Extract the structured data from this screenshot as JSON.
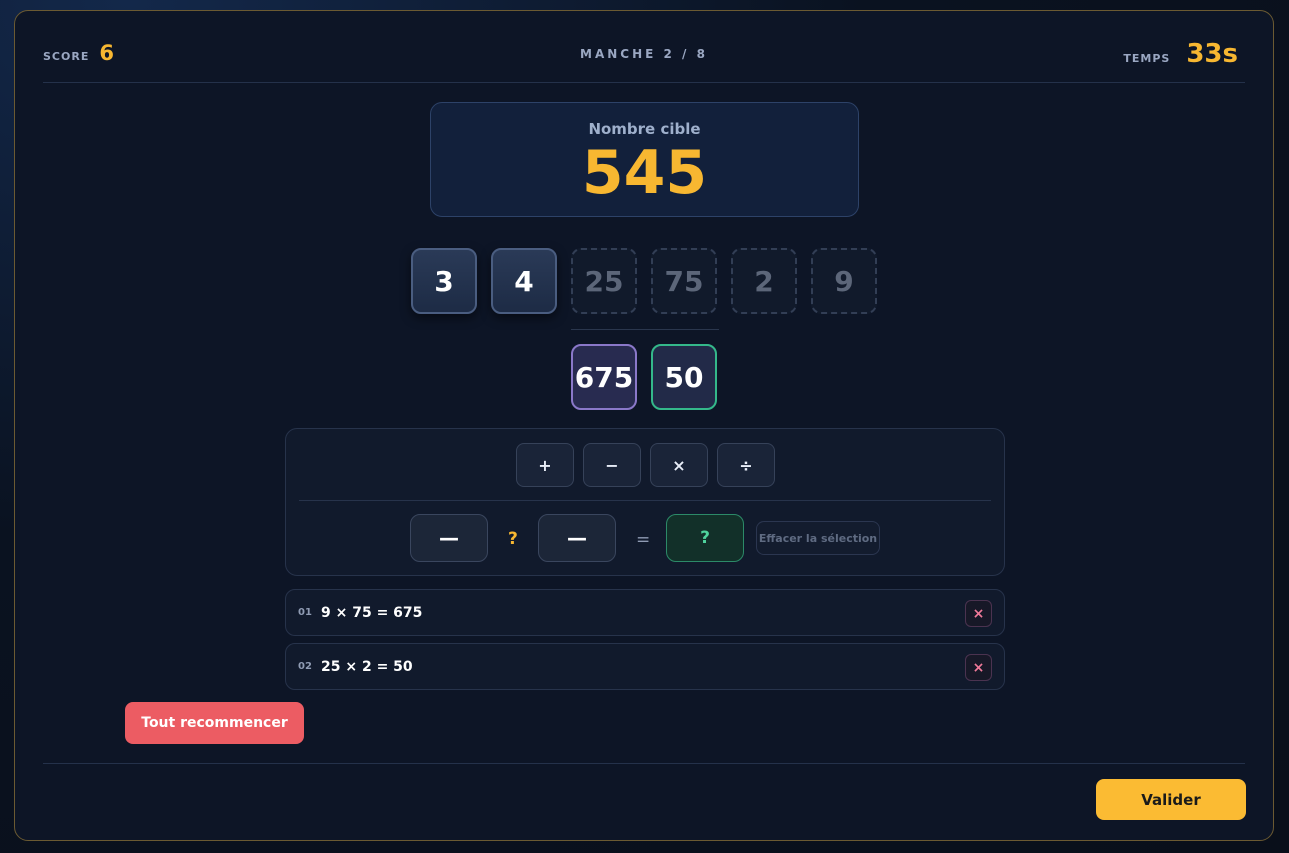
{
  "header": {
    "score_label": "SCORE",
    "score_value": "6",
    "round_label": "MANCHE 2 / 8",
    "time_label": "TEMPS",
    "time_value": "33s"
  },
  "target": {
    "label": "Nombre cible",
    "value": "545"
  },
  "tiles": [
    {
      "value": "3",
      "state": "available"
    },
    {
      "value": "4",
      "state": "available"
    },
    {
      "value": "25",
      "state": "used"
    },
    {
      "value": "75",
      "state": "used"
    },
    {
      "value": "2",
      "state": "used"
    },
    {
      "value": "9",
      "state": "used"
    }
  ],
  "results": [
    {
      "value": "675"
    },
    {
      "value": "50"
    }
  ],
  "operators": {
    "add": "+",
    "sub": "−",
    "mul": "×",
    "div": "÷"
  },
  "builder": {
    "left_slot": "—",
    "operator_slot": "?",
    "right_slot": "—",
    "equals": "=",
    "result_slot": "?",
    "clear_label": "Effacer la sélection"
  },
  "history": [
    {
      "index": "01",
      "expression": "9 × 75 = 675",
      "remove_label": "×"
    },
    {
      "index": "02",
      "expression": "25 × 2 = 50",
      "remove_label": "×"
    }
  ],
  "actions": {
    "reset_label": "Tout recommencer",
    "validate_label": "Valider"
  },
  "colors": {
    "accent": "#f7b731",
    "danger": "#ec5c63",
    "success": "#34b88a",
    "purple": "#8a78c9"
  }
}
